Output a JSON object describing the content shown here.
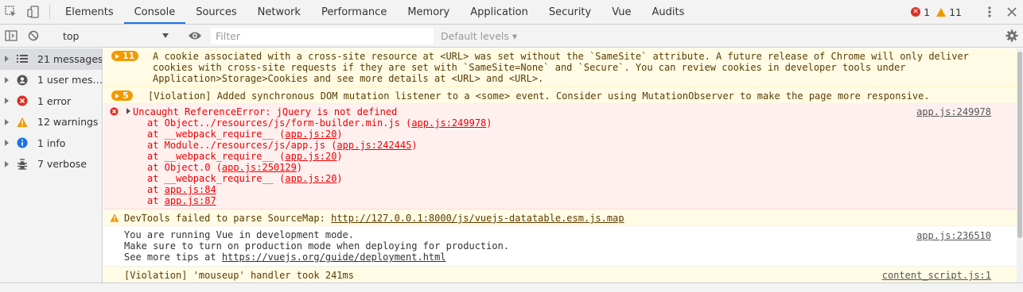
{
  "tabs": [
    "Elements",
    "Console",
    "Sources",
    "Network",
    "Performance",
    "Memory",
    "Application",
    "Security",
    "Vue",
    "Audits"
  ],
  "active_tab": "Console",
  "counts": {
    "errors": "1",
    "warnings": "11"
  },
  "toolbar": {
    "context": "top",
    "filter_placeholder": "Filter",
    "levels": "Default levels ▾"
  },
  "sidebar": {
    "items": [
      {
        "label": "21 messages",
        "icon": "list-icon"
      },
      {
        "label": "1 user mes…",
        "icon": "user-icon"
      },
      {
        "label": "1 error",
        "icon": "error-icon"
      },
      {
        "label": "12 warnings",
        "icon": "warning-icon"
      },
      {
        "label": "1 info",
        "icon": "info-icon"
      },
      {
        "label": "7 verbose",
        "icon": "bug-icon"
      }
    ]
  },
  "messages": {
    "cookie": {
      "count": "11",
      "lines": [
        "A cookie associated with a cross-site resource at <URL> was set without the `SameSite` attribute. A future release of Chrome will only deliver",
        "cookies with cross-site requests if they are set with `SameSite=None` and `Secure`. You can review cookies in developer tools under",
        "Application>Storage>Cookies and see more details at <URL> and <URL>."
      ]
    },
    "violation1": {
      "count": "5",
      "text": "[Violation] Added synchronous DOM mutation listener to a <some> event. Consider using MutationObserver to make the page more responsive."
    },
    "error": {
      "title": "Uncaught ReferenceError: jQuery is not defined",
      "source": "app.js:249978",
      "frames": [
        {
          "pre": "at Object../resources/js/form-builder.min.js (",
          "link": "app.js:249978",
          "post": ")"
        },
        {
          "pre": "at __webpack_require__ (",
          "link": "app.js:20",
          "post": ")"
        },
        {
          "pre": "at Module../resources/js/app.js (",
          "link": "app.js:242445",
          "post": ")"
        },
        {
          "pre": "at __webpack_require__ (",
          "link": "app.js:20",
          "post": ")"
        },
        {
          "pre": "at Object.0 (",
          "link": "app.js:250129",
          "post": ")"
        },
        {
          "pre": "at __webpack_require__ (",
          "link": "app.js:20",
          "post": ")"
        },
        {
          "pre": "at ",
          "link": "app.js:84",
          "post": ""
        },
        {
          "pre": "at ",
          "link": "app.js:87",
          "post": ""
        }
      ]
    },
    "sourcemap": {
      "text": "DevTools failed to parse SourceMap: ",
      "link": "http://127.0.0.1:8000/js/vuejs-datatable.esm.js.map"
    },
    "vue": {
      "lines": [
        "You are running Vue in development mode.",
        "Make sure to turn on production mode when deploying for production.",
        "See more tips at "
      ],
      "link": "https://vuejs.org/guide/deployment.html",
      "source": "app.js:236510"
    },
    "violation2": {
      "text": "[Violation] 'mouseup' handler took 241ms",
      "source": "content_script.js:1"
    }
  }
}
